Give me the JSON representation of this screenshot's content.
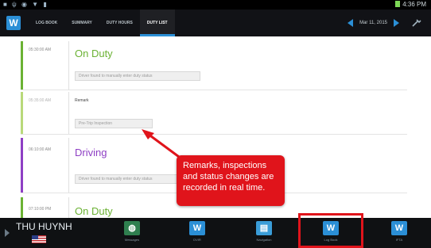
{
  "statusbar": {
    "left_icons": "■ ψ ◉ ▼ ▮",
    "time": "4:36 PM"
  },
  "app": {
    "logo_letter": "W"
  },
  "tabs": [
    {
      "label": "LOG BOOK",
      "active": false
    },
    {
      "label": "SUMMARY",
      "active": false
    },
    {
      "label": "DUTY HOURS",
      "active": false
    },
    {
      "label": "DUTY LIST",
      "active": true
    }
  ],
  "datenav": {
    "date": "Mar 11, 2015"
  },
  "entries": [
    {
      "time": "05:30:00 AM",
      "status": "On Duty",
      "status_color": "#6bb234",
      "box": "Driver found to manually enter duty status"
    },
    {
      "time": "05:35:00 AM",
      "note": "Remark",
      "box": "Pre-Trip Inspection",
      "status_color": "#b9d97a"
    },
    {
      "time": "06:10:00 AM",
      "status": "Driving",
      "status_color": "#8e3fc4",
      "box": "Driver found to manually enter duty status"
    },
    {
      "time": "07:10:00 PM",
      "status": "On Duty",
      "status_color": "#6bb234"
    }
  ],
  "callout": {
    "text": "Remarks, inspections and status changes are recorded in real time."
  },
  "bottombar": {
    "driver_name": "THU HUYNH",
    "items": [
      {
        "label": "Messages",
        "icon": "globe-icon",
        "color": "#2f7f4f"
      },
      {
        "label": "DVIR",
        "icon": "w-icon",
        "color": "#2b8fd6"
      },
      {
        "label": "Navigation",
        "icon": "map-icon",
        "color": "#3a9dd8"
      },
      {
        "label": "Log Book",
        "icon": "w-icon",
        "color": "#2b8fd6"
      },
      {
        "label": "IFTA",
        "icon": "w-icon",
        "color": "#2b8fd6"
      }
    ]
  }
}
